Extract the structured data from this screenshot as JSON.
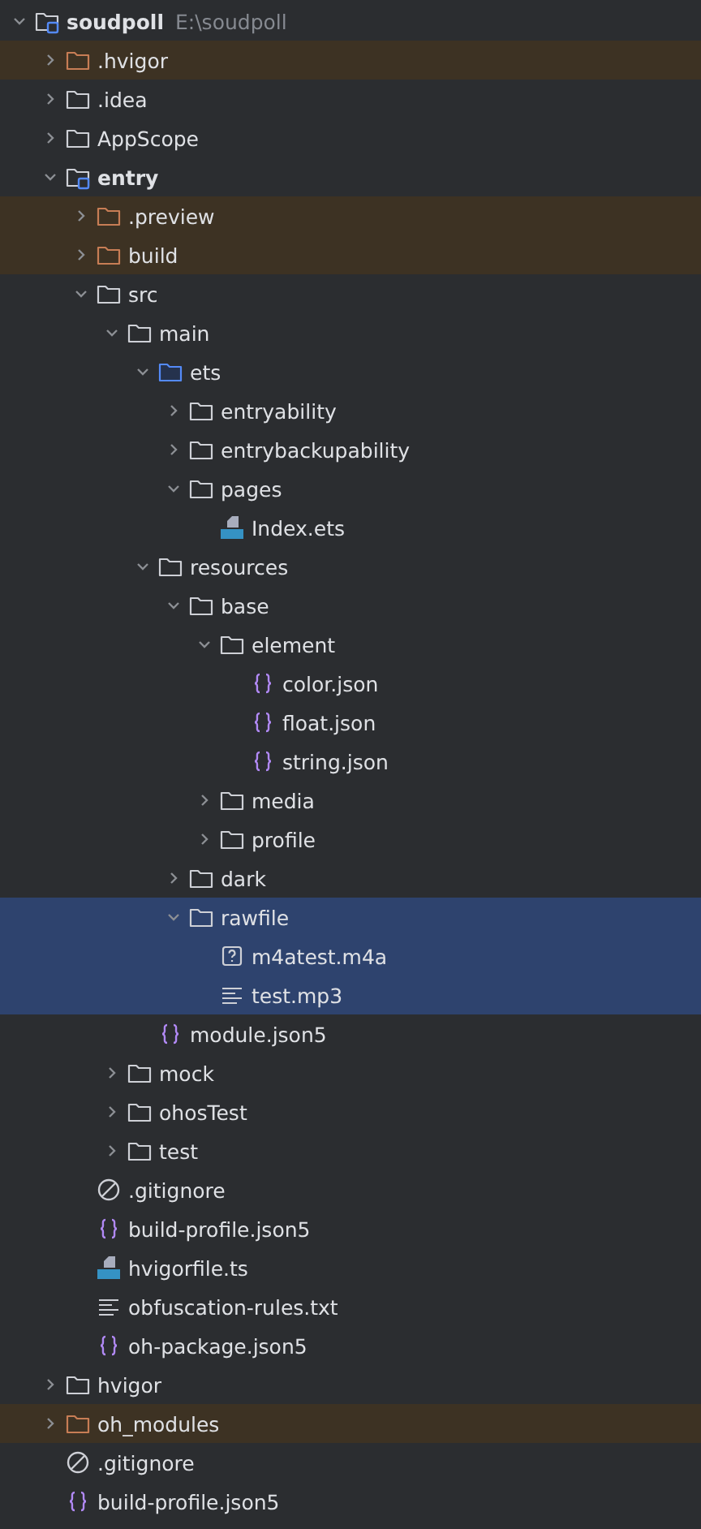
{
  "tree": [
    {
      "name": "soudpoll",
      "path": "E:\\soudpoll",
      "kind": "module",
      "expanded": true,
      "excluded": false,
      "selected": false,
      "children": [
        {
          "name": ".hvigor",
          "kind": "folder",
          "expanded": false,
          "excluded": true,
          "selected": false
        },
        {
          "name": ".idea",
          "kind": "folder",
          "expanded": false,
          "excluded": false,
          "selected": false
        },
        {
          "name": "AppScope",
          "kind": "folder",
          "expanded": false,
          "excluded": false,
          "selected": false
        },
        {
          "name": "entry",
          "kind": "module",
          "expanded": true,
          "excluded": false,
          "selected": false,
          "children": [
            {
              "name": ".preview",
              "kind": "folder",
              "expanded": false,
              "excluded": true,
              "selected": false
            },
            {
              "name": "build",
              "kind": "folder",
              "expanded": false,
              "excluded": true,
              "selected": false
            },
            {
              "name": "src",
              "kind": "folder",
              "expanded": true,
              "excluded": false,
              "selected": false,
              "children": [
                {
                  "name": "main",
                  "kind": "folder",
                  "expanded": true,
                  "excluded": false,
                  "selected": false,
                  "children": [
                    {
                      "name": "ets",
                      "kind": "source",
                      "expanded": true,
                      "excluded": false,
                      "selected": false,
                      "children": [
                        {
                          "name": "entryability",
                          "kind": "folder",
                          "expanded": false,
                          "excluded": false,
                          "selected": false
                        },
                        {
                          "name": "entrybackupability",
                          "kind": "folder",
                          "expanded": false,
                          "excluded": false,
                          "selected": false
                        },
                        {
                          "name": "pages",
                          "kind": "folder",
                          "expanded": true,
                          "excluded": false,
                          "selected": false,
                          "children": [
                            {
                              "name": "Index.ets",
                              "kind": "ets",
                              "excluded": false,
                              "selected": false
                            }
                          ]
                        }
                      ]
                    },
                    {
                      "name": "resources",
                      "kind": "folder",
                      "expanded": true,
                      "excluded": false,
                      "selected": false,
                      "children": [
                        {
                          "name": "base",
                          "kind": "folder",
                          "expanded": true,
                          "excluded": false,
                          "selected": false,
                          "children": [
                            {
                              "name": "element",
                              "kind": "folder",
                              "expanded": true,
                              "excluded": false,
                              "selected": false,
                              "children": [
                                {
                                  "name": "color.json",
                                  "kind": "json",
                                  "excluded": false,
                                  "selected": false
                                },
                                {
                                  "name": "float.json",
                                  "kind": "json",
                                  "excluded": false,
                                  "selected": false
                                },
                                {
                                  "name": "string.json",
                                  "kind": "json",
                                  "excluded": false,
                                  "selected": false
                                }
                              ]
                            },
                            {
                              "name": "media",
                              "kind": "folder",
                              "expanded": false,
                              "excluded": false,
                              "selected": false
                            },
                            {
                              "name": "profile",
                              "kind": "folder",
                              "expanded": false,
                              "excluded": false,
                              "selected": false
                            }
                          ]
                        },
                        {
                          "name": "dark",
                          "kind": "folder",
                          "expanded": false,
                          "excluded": false,
                          "selected": false
                        },
                        {
                          "name": "rawfile",
                          "kind": "folder",
                          "expanded": true,
                          "excluded": false,
                          "selected": true,
                          "children": [
                            {
                              "name": "m4atest.m4a",
                              "kind": "unknown",
                              "excluded": false,
                              "selected": true
                            },
                            {
                              "name": "test.mp3",
                              "kind": "text",
                              "excluded": false,
                              "selected": true
                            }
                          ]
                        }
                      ]
                    },
                    {
                      "name": "module.json5",
                      "kind": "json",
                      "excluded": false,
                      "selected": false
                    }
                  ]
                },
                {
                  "name": "mock",
                  "kind": "folder",
                  "expanded": false,
                  "excluded": false,
                  "selected": false
                },
                {
                  "name": "ohosTest",
                  "kind": "folder",
                  "expanded": false,
                  "excluded": false,
                  "selected": false
                },
                {
                  "name": "test",
                  "kind": "folder",
                  "expanded": false,
                  "excluded": false,
                  "selected": false
                }
              ]
            },
            {
              "name": ".gitignore",
              "kind": "ignore",
              "excluded": false,
              "selected": false
            },
            {
              "name": "build-profile.json5",
              "kind": "json",
              "excluded": false,
              "selected": false
            },
            {
              "name": "hvigorfile.ts",
              "kind": "ts",
              "excluded": false,
              "selected": false
            },
            {
              "name": "obfuscation-rules.txt",
              "kind": "text",
              "excluded": false,
              "selected": false
            },
            {
              "name": "oh-package.json5",
              "kind": "json",
              "excluded": false,
              "selected": false
            }
          ]
        },
        {
          "name": "hvigor",
          "kind": "folder",
          "expanded": false,
          "excluded": false,
          "selected": false
        },
        {
          "name": "oh_modules",
          "kind": "folder",
          "expanded": false,
          "excluded": true,
          "selected": false
        },
        {
          "name": ".gitignore",
          "kind": "ignore",
          "excluded": false,
          "selected": false
        },
        {
          "name": "build-profile.json5",
          "kind": "json",
          "excluded": false,
          "selected": false
        }
      ]
    }
  ]
}
